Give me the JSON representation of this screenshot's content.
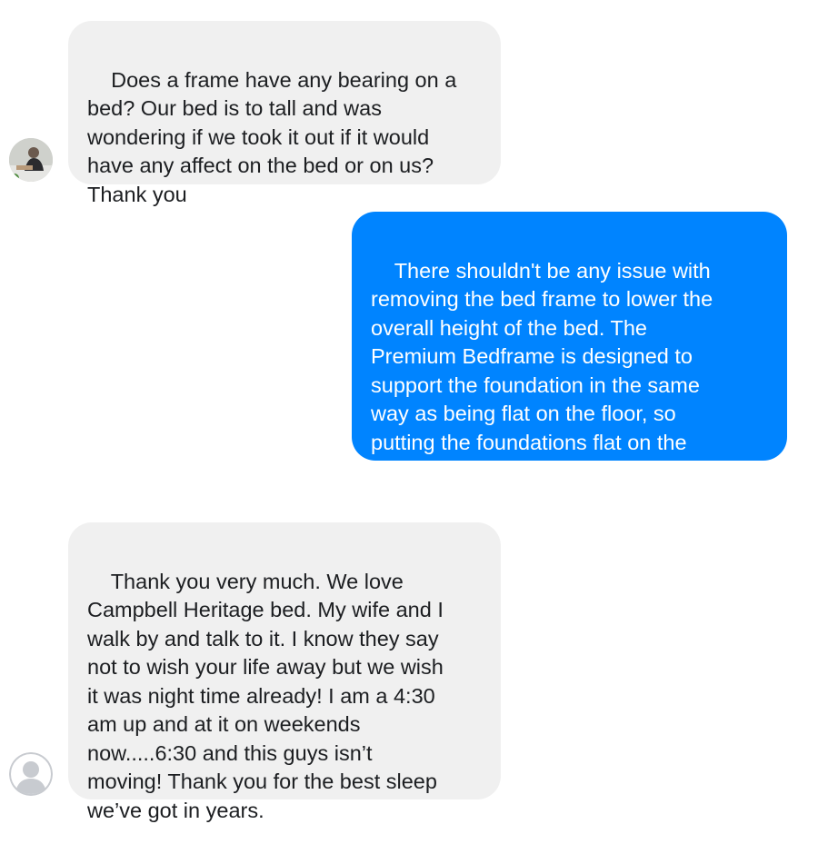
{
  "conversation": {
    "messages": [
      {
        "sender": "customer",
        "avatar": "customer-photo-avatar",
        "text": "Does a frame have any bearing on a\nbed? Our bed is to tall and was\nwondering if we took it out if it would\nhave any affect on the bed or on us?\nThank you"
      },
      {
        "sender": "business",
        "text": "There shouldn't be any issue with\nremoving the bed frame to lower the\noverall height of the bed. The\nPremium Bedframe is designed to\nsupport the foundation in the same\nway as being flat on the floor, so\nputting the foundations flat on the\nfloor is very supportive."
      },
      {
        "sender": "customer",
        "avatar": "default-user-avatar",
        "text": "Thank you very much. We love\nCampbell Heritage bed. My wife and I\nwalk by and talk to it. I know they say\nnot to wish your life away but we wish\nit was night time already! I am a 4:30\nam up and at it on weekends\nnow.....6:30 and this guys isn’t\nmoving! Thank you for the best sleep\nwe’ve got in years."
      }
    ]
  },
  "colors": {
    "incoming_bubble": "#f0f0f0",
    "outgoing_bubble": "#0084ff",
    "incoming_text": "#1c1e21",
    "outgoing_text": "#ffffff"
  }
}
